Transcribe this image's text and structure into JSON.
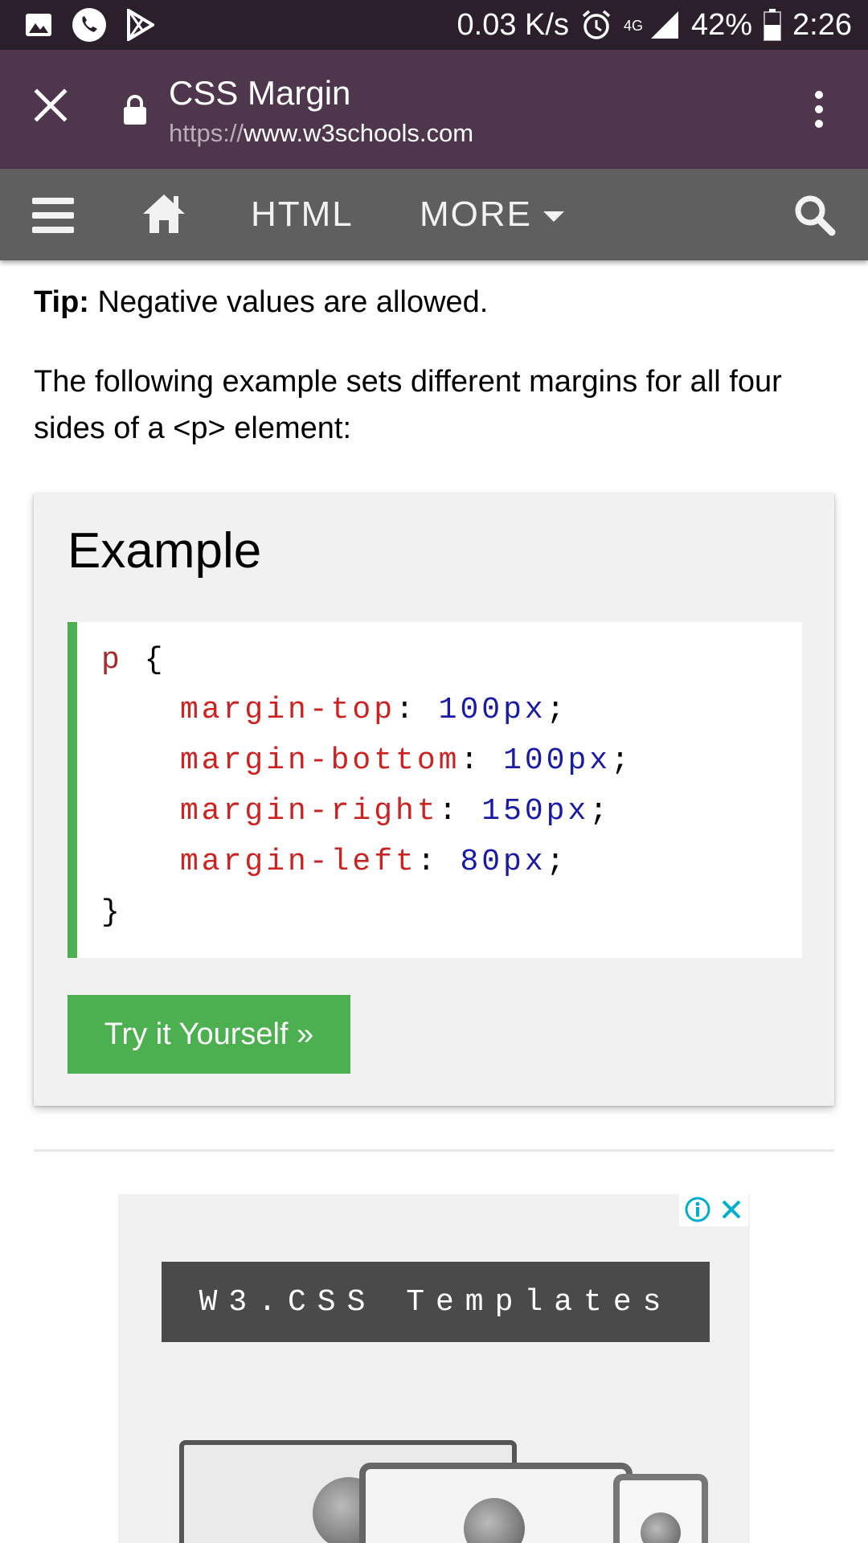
{
  "status_bar": {
    "speed": "0.03 K/s",
    "network": "4G",
    "battery": "42%",
    "time": "2:26",
    "icons": [
      "image-icon",
      "whatsapp-icon",
      "play-store-icon",
      "alarm-icon",
      "signal-icon",
      "battery-icon"
    ]
  },
  "browser": {
    "title": "CSS Margin",
    "url_scheme": "https://",
    "url_host": "www.w3schools.com"
  },
  "nav": {
    "html_label": "HTML",
    "more_label": "MORE"
  },
  "content": {
    "tip_label": "Tip:",
    "tip_text": " Negative values are allowed.",
    "paragraph": "The following example sets different margins for all four sides of a <p> element:"
  },
  "example": {
    "heading": "Example",
    "code": {
      "selector": "p",
      "open_brace": "{",
      "close_brace": "}",
      "declarations": [
        {
          "property": "margin-top",
          "value": "100px"
        },
        {
          "property": "margin-bottom",
          "value": "100px"
        },
        {
          "property": "margin-right",
          "value": "150px"
        },
        {
          "property": "margin-left",
          "value": "80px"
        }
      ]
    },
    "try_button": "Try it Yourself »"
  },
  "ad": {
    "banner_text": "W3.CSS Templates"
  },
  "colors": {
    "statusbar": "#2b1f2b",
    "browser_toolbar": "#4e364d",
    "site_nav": "#5f5f5f",
    "accent_green": "#4caf50"
  }
}
